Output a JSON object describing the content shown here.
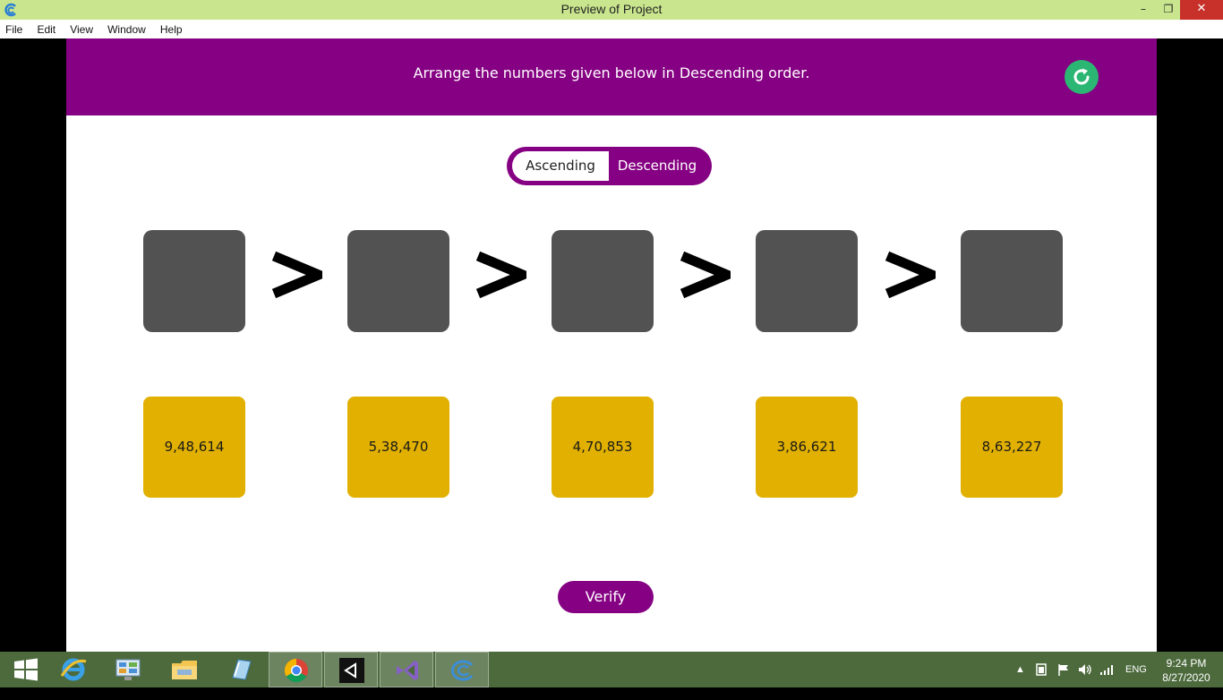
{
  "window": {
    "title": "Preview of Project",
    "minimize": "–",
    "maximize": "❐",
    "close": "✕"
  },
  "menu": [
    "File",
    "Edit",
    "View",
    "Window",
    "Help"
  ],
  "game": {
    "instruction": "Arrange the numbers given below in Descending order.",
    "toggle": {
      "ascending": "Ascending",
      "descending": "Descending",
      "selected": "Descending"
    },
    "comparator": ">",
    "tiles": [
      "9,48,614",
      "5,38,470",
      "4,70,853",
      "3,86,621",
      "8,63,227"
    ],
    "verify_label": "Verify",
    "colors": {
      "banner": "#850082",
      "slot": "#525252",
      "tile": "#e1b000",
      "reset": "#2bb673"
    }
  },
  "taskbar": {
    "apps": [
      "start-icon",
      "internet-explorer-icon",
      "control-panel-icon",
      "file-explorer-icon",
      "notepad-icon",
      "chrome-icon",
      "unity-icon",
      "visual-studio-icon",
      "preview-app-icon"
    ],
    "tray": {
      "language": "ENG",
      "time": "9:24 PM",
      "date": "8/27/2020"
    }
  }
}
